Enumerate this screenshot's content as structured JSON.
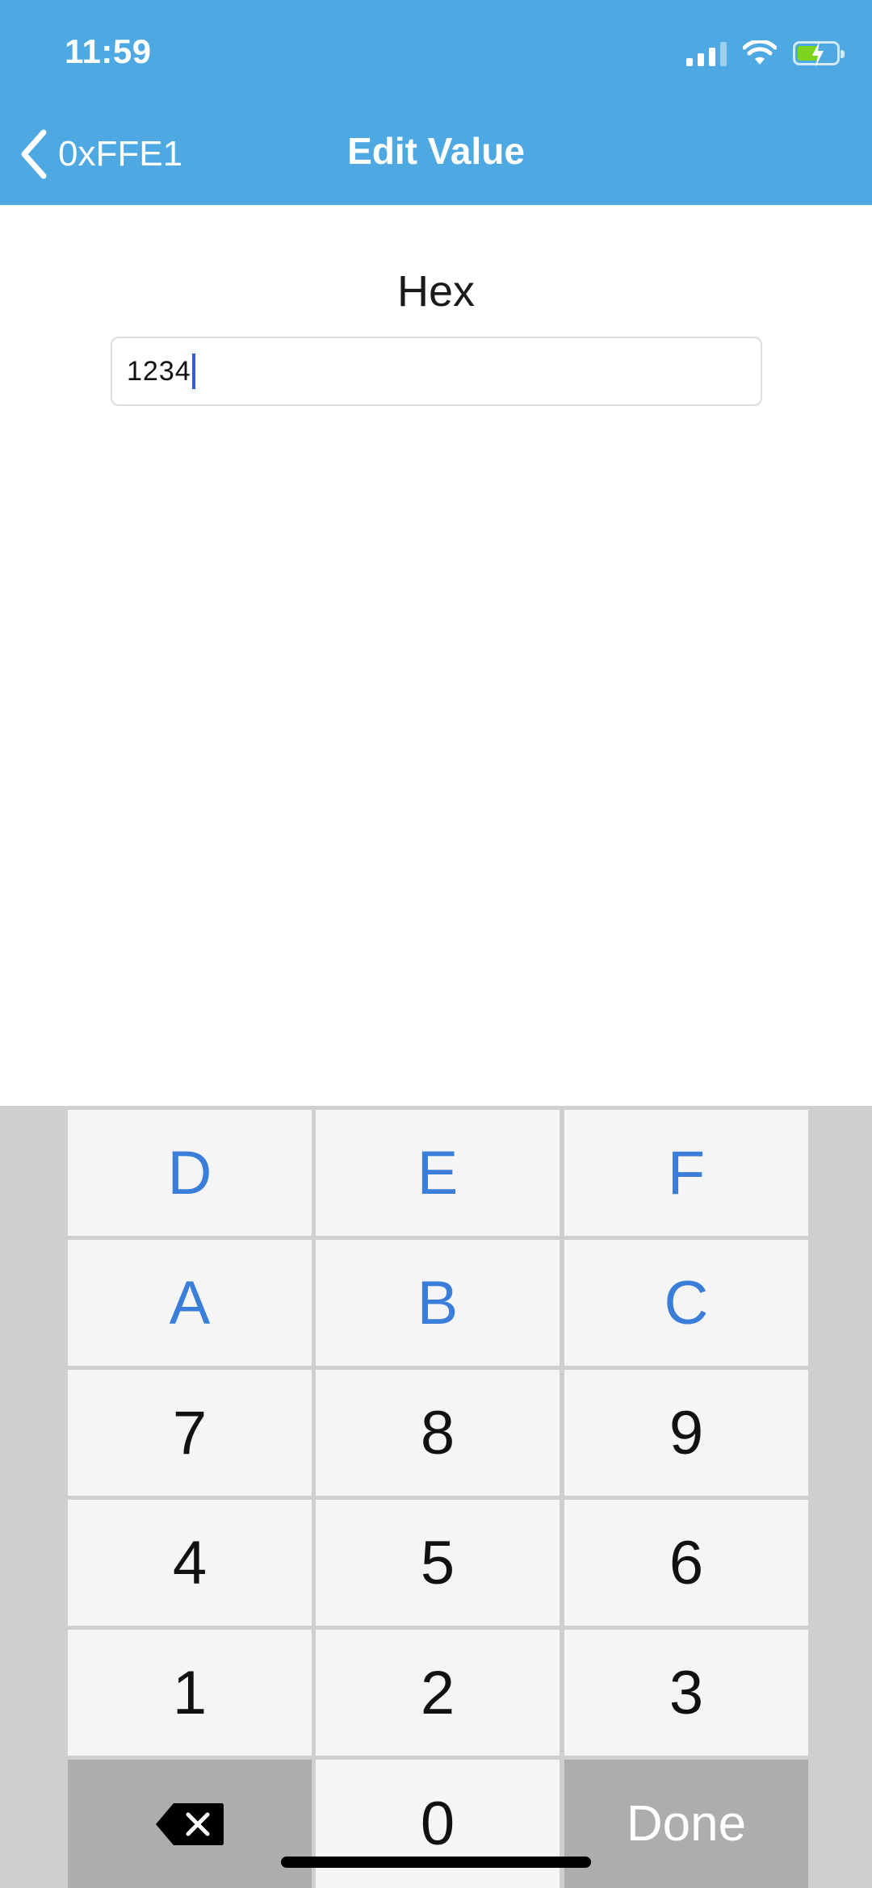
{
  "colors": {
    "header_bg": "#4ea9e2",
    "accent_blue": "#3a7ed9",
    "battery_green": "#7ed321"
  },
  "status": {
    "time": "11:59",
    "icons": [
      "signal-icon",
      "wifi-icon",
      "battery-charging-icon"
    ]
  },
  "nav": {
    "back_label": "0xFFE1",
    "title": "Edit Value"
  },
  "field": {
    "label": "Hex",
    "value": "1234"
  },
  "keypad": {
    "rows": [
      [
        "D",
        "E",
        "F"
      ],
      [
        "A",
        "B",
        "C"
      ],
      [
        "7",
        "8",
        "9"
      ],
      [
        "4",
        "5",
        "6"
      ],
      [
        "1",
        "2",
        "3"
      ]
    ],
    "zero": "0",
    "done": "Done",
    "delete_icon": "backspace-icon"
  }
}
